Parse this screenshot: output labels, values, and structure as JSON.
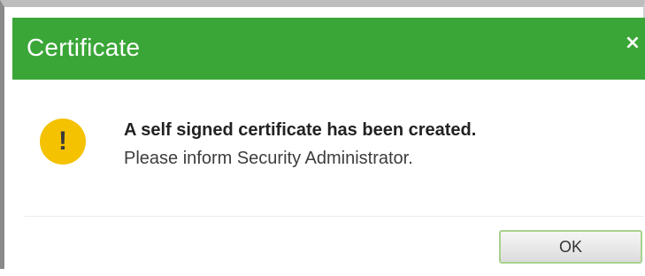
{
  "dialog": {
    "title": "Certificate",
    "close_glyph": "×",
    "icon": "warning-icon",
    "icon_glyph": "!",
    "message_title": "A self signed certificate has been created.",
    "message_subtitle": "Please inform Security Administrator.",
    "ok_label": "OK"
  },
  "colors": {
    "titlebar": "#3aa637",
    "warning": "#f4c200",
    "ok_border": "#a9d18e"
  }
}
